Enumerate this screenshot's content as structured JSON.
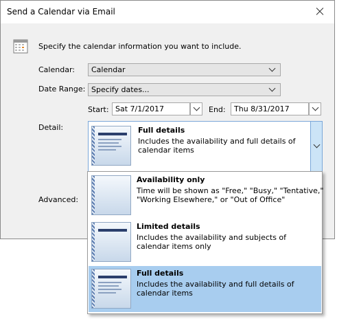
{
  "window": {
    "title": "Send a Calendar via Email"
  },
  "intro": "Specify the calendar information you want to include.",
  "calendar": {
    "label": "Calendar:",
    "value": "Calendar"
  },
  "date_range": {
    "label": "Date Range:",
    "value": "Specify dates..."
  },
  "start": {
    "label": "Start:",
    "value": "Sat 7/1/2017"
  },
  "end": {
    "label": "End:",
    "value": "Thu 8/31/2017"
  },
  "detail": {
    "label": "Detail:",
    "selected_title": "Full details",
    "selected_desc": "Includes the availability and full details of\ncalendar items"
  },
  "advanced": {
    "label": "Advanced:"
  },
  "options": [
    {
      "title": "Availability only",
      "desc": "Time will be shown as \"Free,\" \"Busy,\" \"Tentative,\"\n\"Working Elsewhere,\" or \"Out of Office\""
    },
    {
      "title": "Limited details",
      "desc": "Includes the availability and subjects of\ncalendar items only"
    },
    {
      "title": "Full details",
      "desc": "Includes the availability and full details of\ncalendar items"
    }
  ],
  "colors": {
    "selection": "#a8cdef",
    "focus_border": "#7aa7d9",
    "dialog_bg": "#f0f0f0"
  }
}
